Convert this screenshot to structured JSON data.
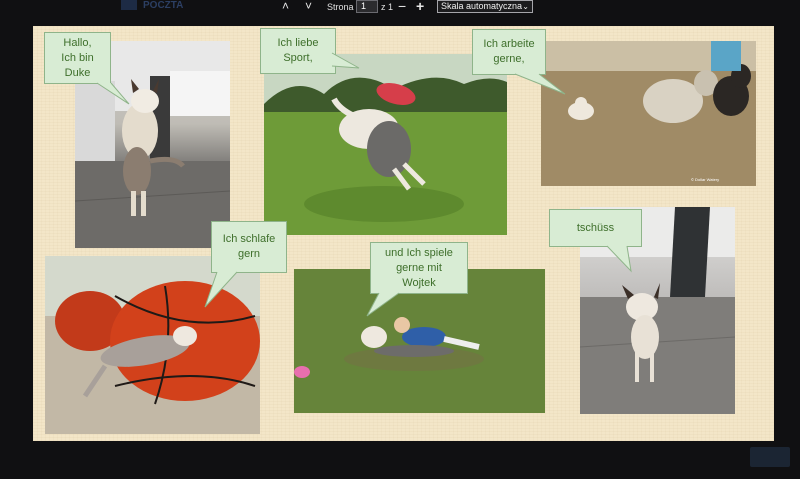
{
  "toolbar": {
    "brand": "POCZTA",
    "prev_page": "˄",
    "next_page": "˅",
    "page_label": "Strona",
    "page_value": "1",
    "page_total": "z 1",
    "zoom_out": "−",
    "zoom_in": "+",
    "zoom_value": "Skala automatyczna"
  },
  "bubbles": {
    "duke": "Hallo,\nIch bin\nDuke",
    "sport": "Ich liebe\nSport,",
    "work": "Ich arbeite\ngerne,",
    "sleep": "Ich schlafe\ngern",
    "play": "und Ich spiele\ngerne mit\nWojtek",
    "bye": "tschüss"
  },
  "photo_caption": "© Dollar Watery",
  "colors": {
    "background": "#101012",
    "slide": "#f3e6c8",
    "bubble_fill": "#d8ecd4",
    "bubble_text": "#3e6f2b"
  }
}
